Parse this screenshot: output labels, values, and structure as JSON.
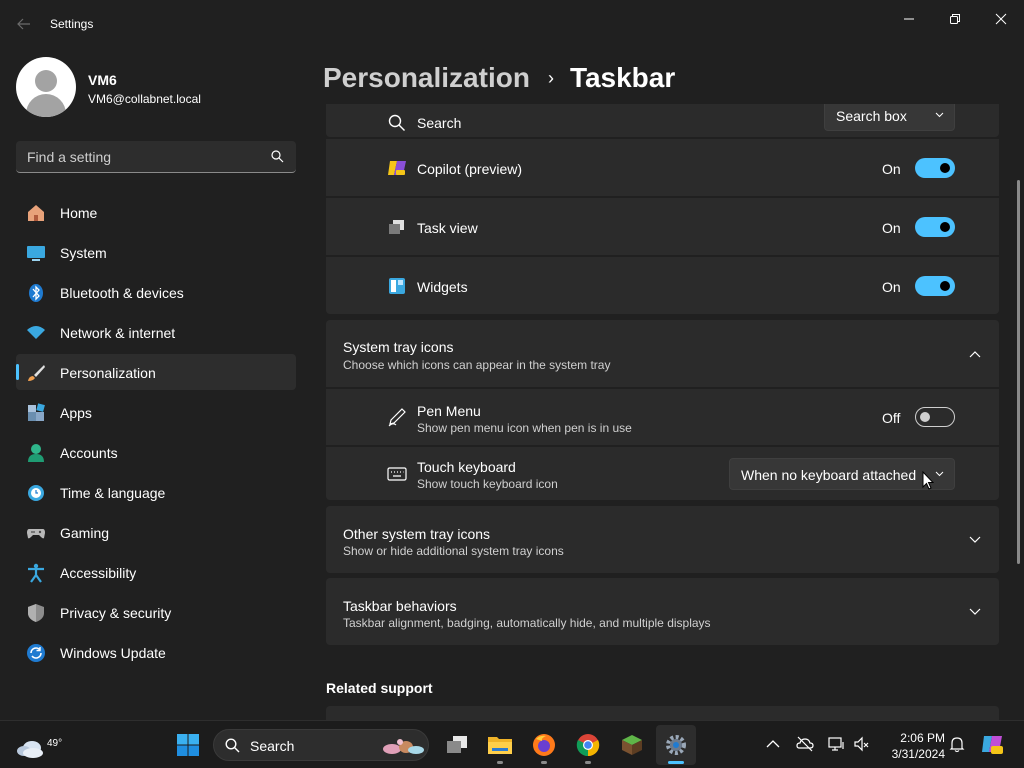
{
  "window": {
    "title": "Settings"
  },
  "profile": {
    "name": "VM6",
    "email": "VM6@collabnet.local"
  },
  "search": {
    "placeholder": "Find a setting"
  },
  "nav": {
    "items": [
      {
        "label": "Home",
        "icon": "home-icon"
      },
      {
        "label": "System",
        "icon": "system-icon"
      },
      {
        "label": "Bluetooth & devices",
        "icon": "bluetooth-icon"
      },
      {
        "label": "Network & internet",
        "icon": "wifi-icon"
      },
      {
        "label": "Personalization",
        "icon": "brush-icon",
        "active": true
      },
      {
        "label": "Apps",
        "icon": "apps-icon"
      },
      {
        "label": "Accounts",
        "icon": "account-icon"
      },
      {
        "label": "Time & language",
        "icon": "globe-clock-icon"
      },
      {
        "label": "Gaming",
        "icon": "gamepad-icon"
      },
      {
        "label": "Accessibility",
        "icon": "accessibility-icon"
      },
      {
        "label": "Privacy & security",
        "icon": "shield-icon"
      },
      {
        "label": "Windows Update",
        "icon": "update-icon"
      }
    ]
  },
  "breadcrumb": {
    "parent": "Personalization",
    "separator": "›",
    "current": "Taskbar"
  },
  "taskbar_items": {
    "search": {
      "label": "Search",
      "value": "Search box"
    },
    "copilot": {
      "label": "Copilot (preview)",
      "state": "On"
    },
    "task_view": {
      "label": "Task view",
      "state": "On"
    },
    "widgets": {
      "label": "Widgets",
      "state": "On"
    }
  },
  "system_tray": {
    "title": "System tray icons",
    "subtitle": "Choose which icons can appear in the system tray",
    "pen_menu": {
      "label": "Pen Menu",
      "sub": "Show pen menu icon when pen is in use",
      "state": "Off"
    },
    "touch_keyboard": {
      "label": "Touch keyboard",
      "sub": "Show touch keyboard icon",
      "value": "When no keyboard attached"
    }
  },
  "other_tray": {
    "title": "Other system tray icons",
    "subtitle": "Show or hide additional system tray icons"
  },
  "behaviors": {
    "title": "Taskbar behaviors",
    "subtitle": "Taskbar alignment, badging, automatically hide, and multiple displays"
  },
  "related": {
    "title": "Related support"
  },
  "taskbar": {
    "weather_temp": "49°",
    "search_label": "Search",
    "time": "2:06 PM",
    "date": "3/31/2024"
  },
  "colors": {
    "accent": "#4cc2ff",
    "background": "#202020",
    "card": "#2b2b2b"
  }
}
